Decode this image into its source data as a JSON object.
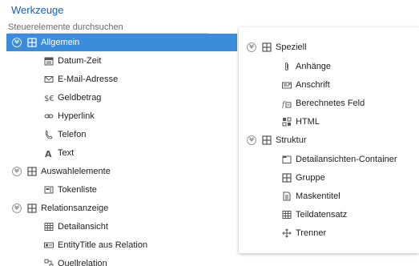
{
  "header": {
    "title": "Werkzeuge"
  },
  "search": {
    "placeholder": "Steuerelemente durchsuchen"
  },
  "left_panel": {
    "items": [
      {
        "label": "Allgemein"
      },
      {
        "label": "Datum-Zeit"
      },
      {
        "label": "E-Mail-Adresse"
      },
      {
        "label": "Geldbetrag"
      },
      {
        "label": "Hyperlink"
      },
      {
        "label": "Telefon"
      },
      {
        "label": "Text"
      },
      {
        "label": "Auswahlelemente"
      },
      {
        "label": "Tokenliste"
      },
      {
        "label": "Relationsanzeige"
      },
      {
        "label": "Detailansicht"
      },
      {
        "label": "EntityTitle aus Relation"
      },
      {
        "label": "Quellrelation"
      }
    ]
  },
  "right_panel": {
    "items": [
      {
        "label": "Speziell"
      },
      {
        "label": "Anhänge"
      },
      {
        "label": "Anschrift"
      },
      {
        "label": "Berechnetes Feld"
      },
      {
        "label": "HTML"
      },
      {
        "label": "Struktur"
      },
      {
        "label": "Detailansichten-Container"
      },
      {
        "label": "Gruppe"
      },
      {
        "label": "Maskentitel"
      },
      {
        "label": "Teildatensatz"
      },
      {
        "label": "Trenner"
      }
    ]
  },
  "colors": {
    "title": "#1a5fb4",
    "selection": "#3b8ddb",
    "icon": "#555555"
  }
}
